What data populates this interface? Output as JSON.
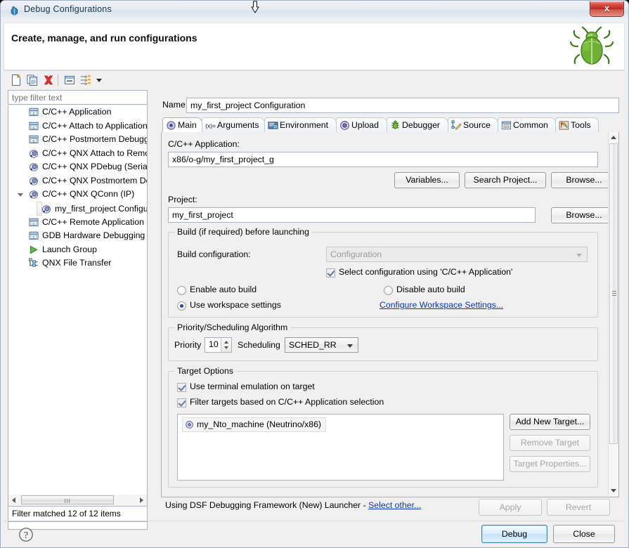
{
  "window": {
    "title": "Debug Configurations",
    "close_label": "x",
    "icon": "debug-bug-icon"
  },
  "header": {
    "title": "Create, manage, and run configurations",
    "icon": "green-bug-icon"
  },
  "toolbar": {
    "items": [
      {
        "name": "new-launch-configuration-icon",
        "glyph": "new-doc"
      },
      {
        "name": "duplicate-launch-configuration-icon",
        "glyph": "copy-doc"
      },
      {
        "name": "delete-launch-configuration-icon",
        "glyph": "red-x"
      },
      {
        "name": "collapse-all-icon",
        "glyph": "collapse"
      },
      {
        "name": "filter-launch-configurations-icon",
        "glyph": "filter-arrows"
      },
      {
        "name": "view-menu-chevron-icon",
        "glyph": "chevron-down"
      }
    ]
  },
  "filter": {
    "placeholder": "type filter text",
    "value": "",
    "status": "Filter matched 12 of 12 items"
  },
  "tree": {
    "items": [
      {
        "label": "C/C++ Application",
        "icon": "c-app-icon",
        "indent": 0,
        "selected": false,
        "twisty": "none"
      },
      {
        "label": "C/C++ Attach to Application",
        "icon": "c-app-icon",
        "indent": 0,
        "selected": false,
        "twisty": "none"
      },
      {
        "label": "C/C++ Postmortem Debugger",
        "icon": "c-app-icon",
        "indent": 0,
        "selected": false,
        "twisty": "none"
      },
      {
        "label": "C/C++ QNX Attach to Remote Process via QConn (IP)",
        "icon": "qnx-icon",
        "indent": 0,
        "selected": false,
        "twisty": "none"
      },
      {
        "label": "C/C++ QNX PDebug (Serial)",
        "icon": "qnx-icon",
        "indent": 0,
        "selected": false,
        "twisty": "none"
      },
      {
        "label": "C/C++ QNX Postmortem Debugging",
        "icon": "qnx-icon",
        "indent": 0,
        "selected": false,
        "twisty": "none"
      },
      {
        "label": "C/C++ QNX QConn (IP)",
        "icon": "qnx-icon",
        "indent": 0,
        "selected": false,
        "twisty": "open"
      },
      {
        "label": "my_first_project Configuration",
        "icon": "qnx-icon",
        "indent": 1,
        "selected": true,
        "twisty": "none"
      },
      {
        "label": "C/C++ Remote Application",
        "icon": "c-app-icon",
        "indent": 0,
        "selected": false,
        "twisty": "none"
      },
      {
        "label": "GDB Hardware Debugging",
        "icon": "c-app-icon",
        "indent": 0,
        "selected": false,
        "twisty": "none"
      },
      {
        "label": "Launch Group",
        "icon": "launch-group-icon",
        "indent": 0,
        "selected": false,
        "twisty": "none"
      },
      {
        "label": "QNX File Transfer",
        "icon": "file-transfer-icon",
        "indent": 0,
        "selected": false,
        "twisty": "none"
      }
    ]
  },
  "config": {
    "name_label": "Name:",
    "name_value": "my_first_project Configuration",
    "tabs": [
      {
        "label": "Main",
        "icon": "main-tab-icon",
        "active": true
      },
      {
        "label": "Arguments",
        "icon": "arguments-tab-icon",
        "active": false
      },
      {
        "label": "Environment",
        "icon": "environment-tab-icon",
        "active": false
      },
      {
        "label": "Upload",
        "icon": "upload-tab-icon",
        "active": false
      },
      {
        "label": "Debugger",
        "icon": "debugger-tab-icon",
        "active": false
      },
      {
        "label": "Source",
        "icon": "source-tab-icon",
        "active": false
      },
      {
        "label": "Common",
        "icon": "common-tab-icon",
        "active": false
      },
      {
        "label": "Tools",
        "icon": "tools-tab-icon",
        "active": false
      }
    ]
  },
  "main_tab": {
    "application_label": "C/C++ Application:",
    "application_value": "x86/o-g/my_first_project_g",
    "variables_button": "Variables...",
    "search_project_button": "Search Project...",
    "browse_app_button": "Browse...",
    "project_label": "Project:",
    "project_value": "my_first_project",
    "browse_project_button": "Browse...",
    "build_group_title": "Build (if required) before launching",
    "build_config_label": "Build configuration:",
    "build_config_value": "Configuration",
    "select_config_checkbox": "Select configuration using 'C/C++ Application'",
    "select_config_checked": true,
    "enable_auto_build": "Enable auto build",
    "enable_auto_build_selected": false,
    "disable_auto_build": "Disable auto build",
    "disable_auto_build_selected": false,
    "use_workspace_settings": "Use workspace settings",
    "use_workspace_settings_selected": true,
    "configure_workspace_link": "Configure Workspace Settings...",
    "priority_group_title": "Priority/Scheduling Algorithm",
    "priority_label": "Priority",
    "priority_value": "10",
    "scheduling_label": "Scheduling",
    "scheduling_value": "SCHED_RR",
    "target_group_title": "Target Options",
    "use_terminal_checkbox": "Use terminal emulation on target",
    "use_terminal_checked": true,
    "filter_targets_checkbox": "Filter targets based on C/C++ Application selection",
    "filter_targets_checked": true,
    "targets": [
      {
        "label": "my_Nto_machine (Neutrino/x86)",
        "icon": "target-icon"
      }
    ],
    "add_new_target_button": "Add New Target...",
    "remove_target_button": "Remove Target",
    "target_properties_button": "Target Properties..."
  },
  "footer": {
    "launcher_text": "Using DSF Debugging Framework (New) Launcher - ",
    "select_other_link": "Select other...",
    "apply_button": "Apply",
    "revert_button": "Revert",
    "help_icon": "help-question-icon",
    "debug_button": "Debug",
    "close_button": "Close"
  },
  "colors": {
    "accent": "#3c7fb1",
    "link": "#0a35c0",
    "close_red": "#b9271c",
    "bug_green": "#6aa82e"
  }
}
